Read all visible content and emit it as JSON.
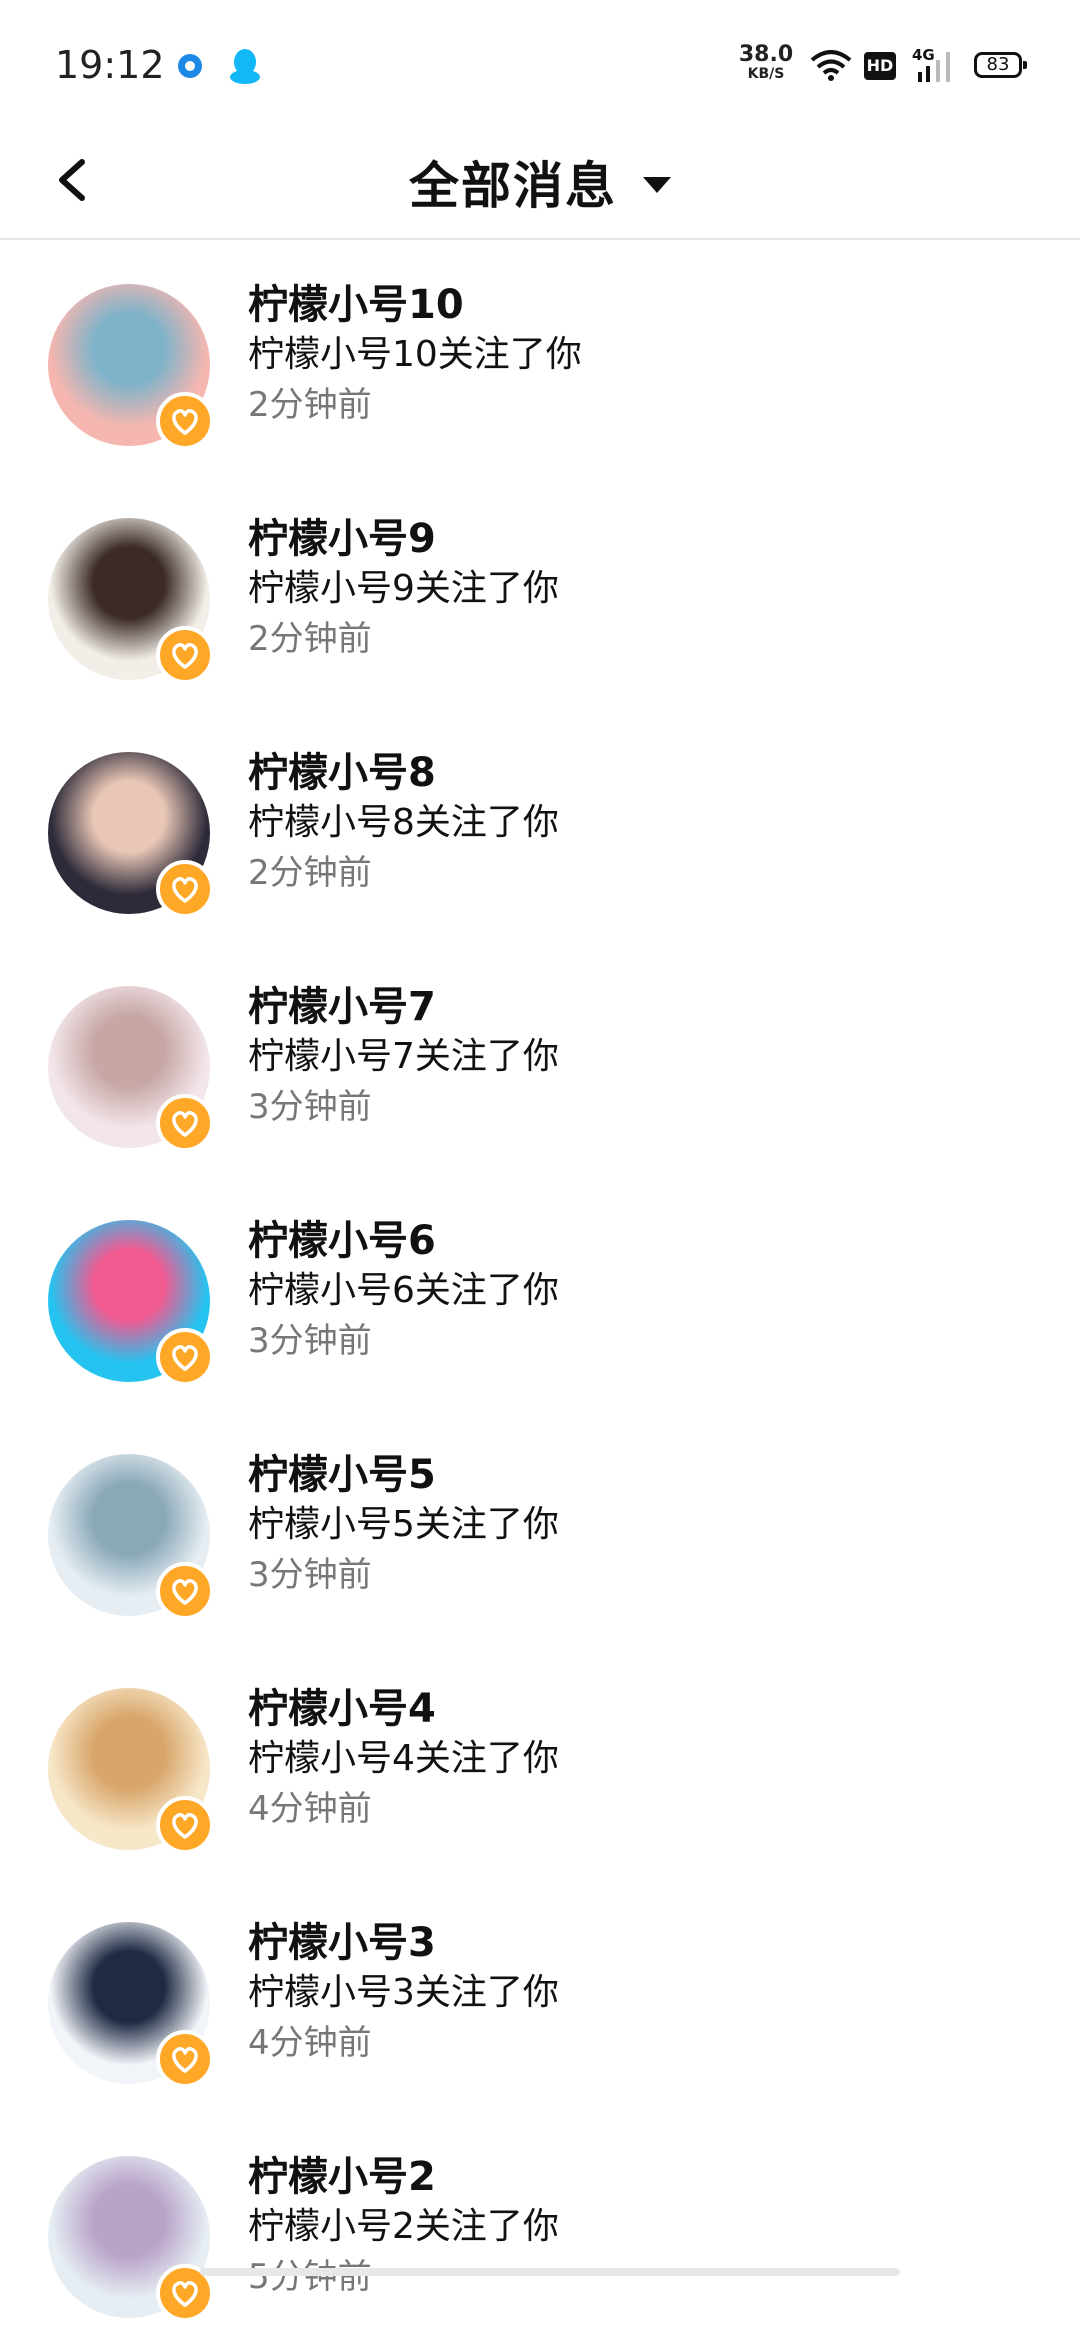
{
  "status_bar": {
    "time": "19:12",
    "net_speed_value": "38.0",
    "net_speed_unit": "KB/S",
    "hd_label": "HD",
    "network_type": "4G",
    "battery": "83"
  },
  "header": {
    "title": "全部消息"
  },
  "colors": {
    "badge": "#ffa726",
    "time_text": "#777777",
    "divider": "#e6e6e6"
  },
  "list": [
    {
      "name": "柠檬小号10",
      "message": "柠檬小号10关注了你",
      "time": "2分钟前",
      "avatar_colors": [
        "#f6b6b0",
        "#7fb3c9"
      ]
    },
    {
      "name": "柠檬小号9",
      "message": "柠檬小号9关注了你",
      "time": "2分钟前",
      "avatar_colors": [
        "#f3efe8",
        "#3b2a26"
      ]
    },
    {
      "name": "柠檬小号8",
      "message": "柠檬小号8关注了你",
      "time": "2分钟前",
      "avatar_colors": [
        "#2d2a3a",
        "#e9c7b6"
      ]
    },
    {
      "name": "柠檬小号7",
      "message": "柠檬小号7关注了你",
      "time": "3分钟前",
      "avatar_colors": [
        "#f3e6ea",
        "#c7a7a6"
      ]
    },
    {
      "name": "柠檬小号6",
      "message": "柠檬小号6关注了你",
      "time": "3分钟前",
      "avatar_colors": [
        "#25c3f0",
        "#f05a91"
      ]
    },
    {
      "name": "柠檬小号5",
      "message": "柠檬小号5关注了你",
      "time": "3分钟前",
      "avatar_colors": [
        "#e7eef3",
        "#8aa8b8"
      ]
    },
    {
      "name": "柠檬小号4",
      "message": "柠檬小号4关注了你",
      "time": "4分钟前",
      "avatar_colors": [
        "#f7e7c9",
        "#d8a56a"
      ]
    },
    {
      "name": "柠檬小号3",
      "message": "柠檬小号3关注了你",
      "time": "4分钟前",
      "avatar_colors": [
        "#f1f4f8",
        "#1f2a44"
      ]
    },
    {
      "name": "柠檬小号2",
      "message": "柠檬小号2关注了你",
      "time": "5分钟前",
      "avatar_colors": [
        "#e6eef3",
        "#b9a3c9"
      ]
    }
  ]
}
